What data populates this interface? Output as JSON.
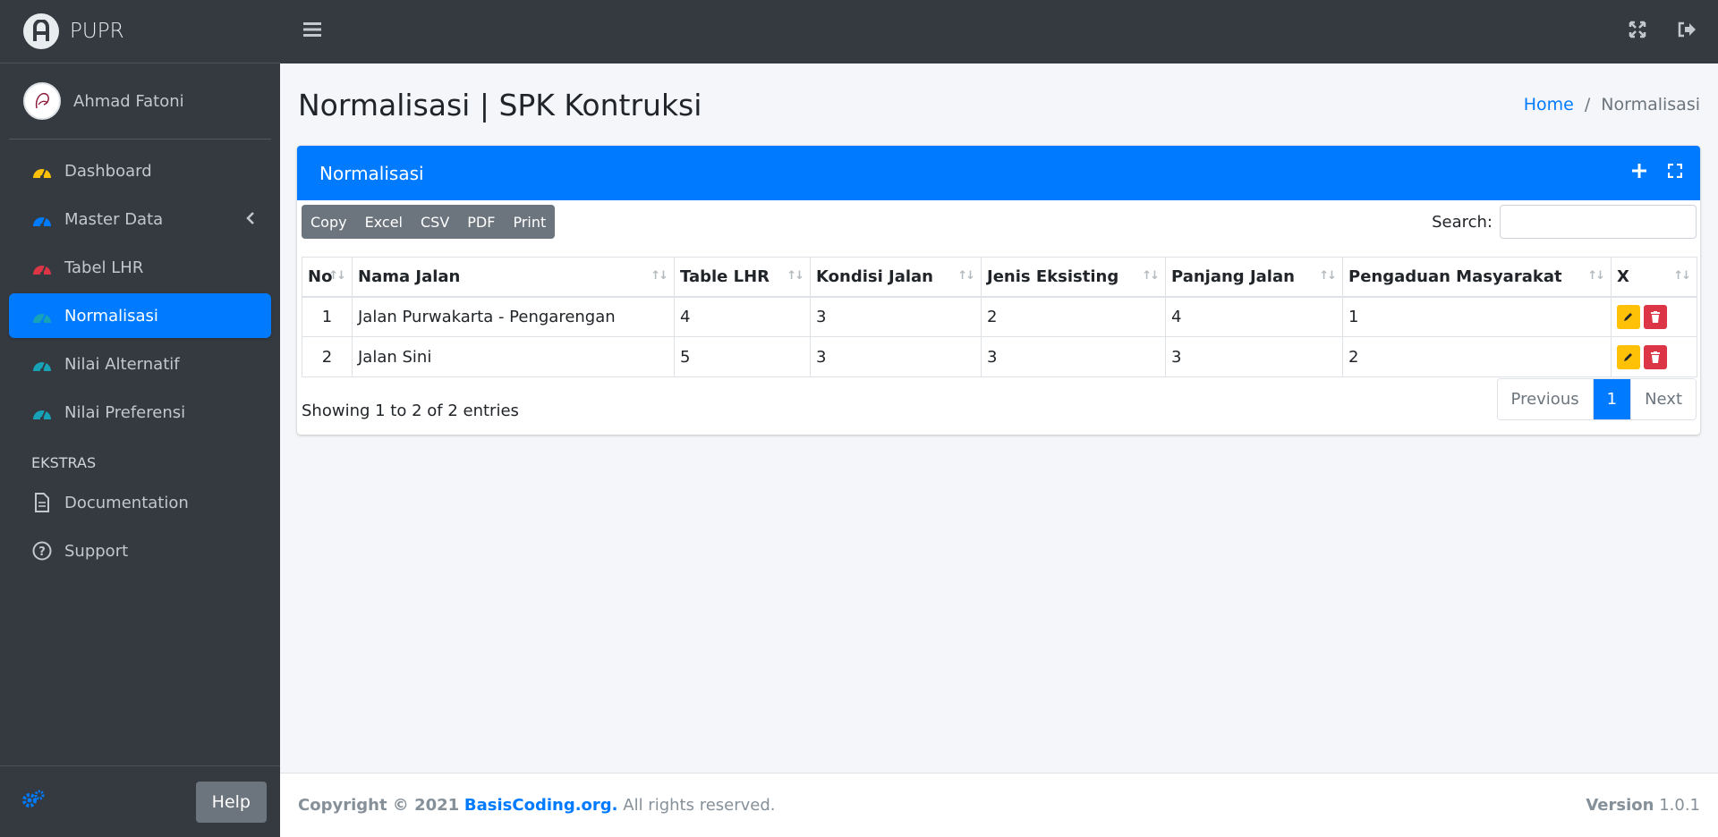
{
  "brand": {
    "name": "PUPR"
  },
  "user": {
    "name": "Ahmad Fatoni"
  },
  "sidebar": {
    "items": [
      {
        "label": "Dashboard",
        "icon": "tachometer-icon",
        "color": "#ffc107"
      },
      {
        "label": "Master Data",
        "icon": "tachometer-icon",
        "color": "#007bff"
      },
      {
        "label": "Tabel LHR",
        "icon": "tachometer-icon",
        "color": "#dc3545"
      },
      {
        "label": "Normalisasi",
        "icon": "tachometer-icon",
        "color": "#17a2b8"
      },
      {
        "label": "Nilai Alternatif",
        "icon": "tachometer-icon",
        "color": "#17a2b8"
      },
      {
        "label": "Nilai Preferensi",
        "icon": "tachometer-icon",
        "color": "#17a2b8"
      }
    ],
    "header": "EKSTRAS",
    "extras": [
      {
        "label": "Documentation",
        "icon": "file-icon"
      },
      {
        "label": "Support",
        "icon": "question-circle-icon"
      }
    ],
    "help_label": "Help"
  },
  "page": {
    "title": "Normalisasi | SPK Kontruksi",
    "breadcrumb": {
      "home": "Home",
      "separator": "/",
      "current": "Normalisasi"
    }
  },
  "card": {
    "title": "Normalisasi",
    "toolbar": [
      "Copy",
      "Excel",
      "CSV",
      "PDF",
      "Print"
    ],
    "search_label": "Search:",
    "search_value": "",
    "columns": [
      "No",
      "Nama Jalan",
      "Table LHR",
      "Kondisi Jalan",
      "Jenis Eksisting",
      "Panjang Jalan",
      "Pengaduan Masyarakat",
      "X"
    ],
    "rows": [
      {
        "no": "1",
        "nama": "Jalan Purwakarta - Pengarengan",
        "lhr": "4",
        "kondisi": "3",
        "jenis": "2",
        "panjang": "4",
        "pengaduan": "1"
      },
      {
        "no": "2",
        "nama": "Jalan Sini",
        "lhr": "5",
        "kondisi": "3",
        "jenis": "3",
        "panjang": "3",
        "pengaduan": "2"
      }
    ],
    "info": "Showing 1 to 2 of 2 entries",
    "pagination": {
      "previous": "Previous",
      "page": "1",
      "next": "Next"
    }
  },
  "footer": {
    "copyright": "Copyright © 2021",
    "link": "BasisCoding.org.",
    "rights": "All rights reserved.",
    "version_label": "Version",
    "version": "1.0.1"
  },
  "colors": {
    "primary": "#007bff",
    "sidebar": "#343a40",
    "warning": "#ffc107",
    "danger": "#dc3545"
  }
}
